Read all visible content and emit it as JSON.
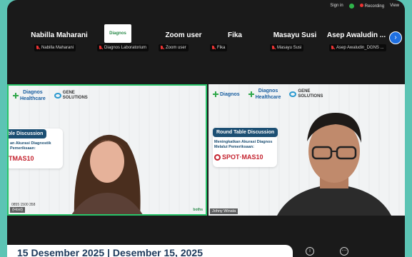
{
  "topbar": {
    "signin": "Sign in",
    "recording": "Recording",
    "view": "View"
  },
  "participants": [
    {
      "name": "Nabilla Maharani",
      "tag": "Nabilla Maharani"
    },
    {
      "name": "",
      "tag": "Diagnos Laboratorium",
      "logo_text": "Diagnos"
    },
    {
      "name": "Zoom user",
      "tag": "Zoom user"
    },
    {
      "name": "Fika",
      "tag": "Fika"
    },
    {
      "name": "Masayu Susi",
      "tag": "Masayu Susi"
    },
    {
      "name": "Asep Awaludin ...",
      "tag": "Asep Awaludin_DGNS ..."
    }
  ],
  "video_left": {
    "brand1": "Diagnos",
    "brand2": "Healthcare",
    "brand3": "GENE SOLUTIONS",
    "title": "ble Discussion",
    "sub1": "an Akurasi Diagnostik",
    "sub2": "Pemeriksaan:",
    "product": "TMAS10",
    "phone": "0855 1500 358",
    "label": "(Host)",
    "corner": "boths"
  },
  "video_right": {
    "brand0": "Diagnos",
    "brand1": "Diagnos",
    "brand2": "Healthcare",
    "brand3": "GENE SOLUTIONS",
    "title": "Round Table Discussion",
    "sub1": "Meningkatkan Akurasi Diagnos",
    "sub2": "Melalui Pemeriksaan:",
    "product": "SPOT·MAS10",
    "label": "Johny Winata"
  },
  "ticker": "15 Desember 2025 | Desember 15, 2025",
  "colors": {
    "accent": "#5cc4b4",
    "active_border": "#29c46a",
    "brand_navy": "#1c4f73",
    "brand_red": "#c4232f"
  },
  "icons": {
    "info": "info-icon",
    "more": "more-icon",
    "next": "chevron-right-icon"
  }
}
